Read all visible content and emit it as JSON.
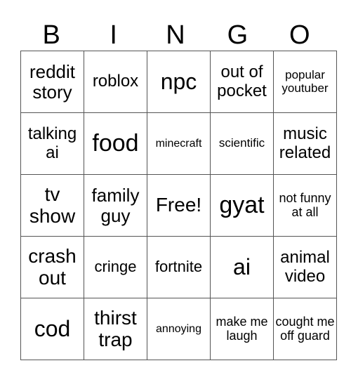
{
  "header": [
    "B",
    "I",
    "N",
    "G",
    "O"
  ],
  "rows": [
    [
      "reddit story",
      "roblox",
      "npc",
      "out of pocket",
      "popular youtuber"
    ],
    [
      "talking ai",
      "food",
      "minecraft",
      "scientific",
      "music related"
    ],
    [
      "tv show",
      "family guy",
      "Free!",
      "gyat",
      "not funny at all"
    ],
    [
      "crash out",
      "cringe",
      "fortnite",
      "ai",
      "animal video"
    ],
    [
      "cod",
      "thirst trap",
      "annoying",
      "make me laugh",
      "cought me off guard"
    ]
  ]
}
